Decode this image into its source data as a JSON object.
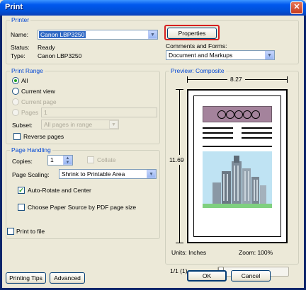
{
  "window": {
    "title": "Print",
    "close_glyph": "✕"
  },
  "printer": {
    "group_title": "Printer",
    "name_label": "Name:",
    "name_value": "Canon LBP3250",
    "status_label": "Status:",
    "status_value": "Ready",
    "type_label": "Type:",
    "type_value": "Canon LBP3250",
    "properties_button": "Properties",
    "comments_label": "Comments and Forms:",
    "comments_value": "Document and Markups"
  },
  "print_range": {
    "group_title": "Print Range",
    "all": "All",
    "current_view": "Current view",
    "current_page": "Current page",
    "pages": "Pages",
    "pages_value": "1",
    "subset_label": "Subset:",
    "subset_value": "All pages in range",
    "reverse_pages": "Reverse pages"
  },
  "page_handling": {
    "group_title": "Page Handling",
    "copies_label": "Copies:",
    "copies_value": "1",
    "collate": "Collate",
    "scaling_label": "Page Scaling:",
    "scaling_value": "Shrink to Printable Area",
    "auto_rotate": "Auto-Rotate and Center",
    "choose_source": "Choose Paper Source by PDF page size"
  },
  "print_to_file": "Print to file",
  "preview": {
    "group_title": "Preview: Composite",
    "width": "8.27",
    "height": "11.69",
    "units": "Units: Inches",
    "zoom": "Zoom: 100%",
    "page_indicator": "1/1 (1)"
  },
  "buttons": {
    "printing_tips": "Printing Tips",
    "advanced": "Advanced",
    "ok": "OK",
    "cancel": "Cancel"
  },
  "colors": {
    "highlight": "#d62020",
    "accent": "#0046d5"
  }
}
